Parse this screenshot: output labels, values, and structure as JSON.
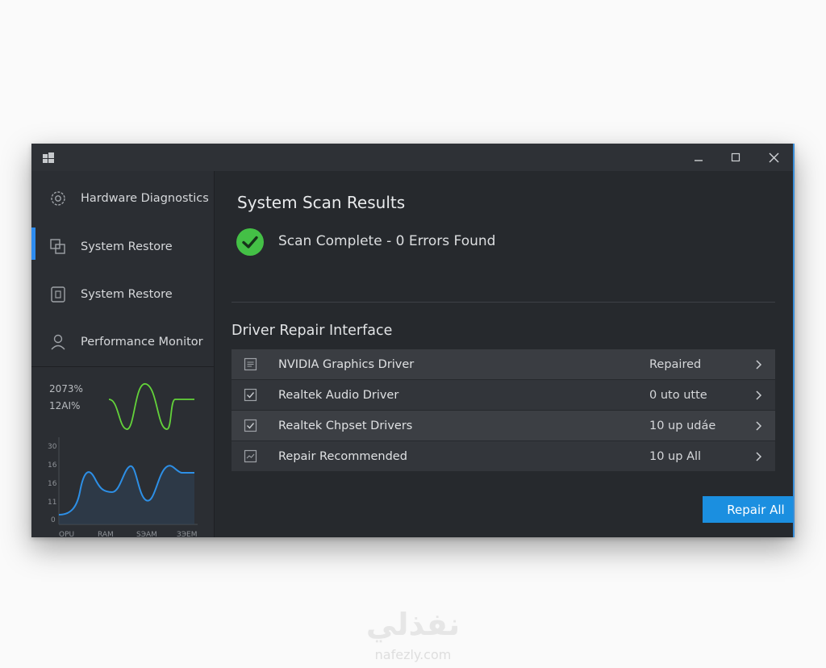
{
  "window_controls": {
    "minimize_icon": "minimize-icon",
    "maximize_icon": "maximize-icon",
    "close_icon": "close-icon"
  },
  "sidebar": {
    "items": [
      {
        "label": "Hardware Diagnostics",
        "icon": "gear-icon",
        "active": false
      },
      {
        "label": "System Restore",
        "icon": "restore-icon",
        "active": true
      },
      {
        "label": "System Restore",
        "icon": "device-icon",
        "active": false
      },
      {
        "label": "Performance Monitor",
        "icon": "user-icon",
        "active": false
      }
    ],
    "mini_stats": [
      "2073%",
      "12AI%"
    ],
    "graph": {
      "y_ticks": [
        "30",
        "16",
        "16",
        "11",
        "0"
      ],
      "x_ticks": [
        "OPU",
        "RAM",
        "SЭAM",
        "ЗЭЕМ"
      ]
    }
  },
  "scan": {
    "title": "System Scan Results",
    "status": "Scan Complete - 0 Errors Found",
    "status_icon": "checkmark-icon"
  },
  "driver": {
    "title": "Driver Repair Interface",
    "rows": [
      {
        "name": "NVIDIA Graphics Driver",
        "status": "Repaired",
        "icon": "document-icon"
      },
      {
        "name": "Realtek Audio Driver",
        "status": "0 uto utte",
        "icon": "checkbox-icon"
      },
      {
        "name": "Realtek Chpset Drivers",
        "status": "10 up udáe",
        "icon": "checkbox-icon"
      },
      {
        "name": "Repair Recommended",
        "status": "10 up All",
        "icon": "chart-icon"
      }
    ]
  },
  "repair_button": "Repair All",
  "watermark": {
    "arabic": "نفذلي",
    "latin": "nafezly.com"
  },
  "colors": {
    "accent": "#2d8cf0",
    "button": "#1b8fe0",
    "success": "#44c046",
    "graph_green": "#63d23a",
    "graph_blue": "#2d8fe6"
  }
}
